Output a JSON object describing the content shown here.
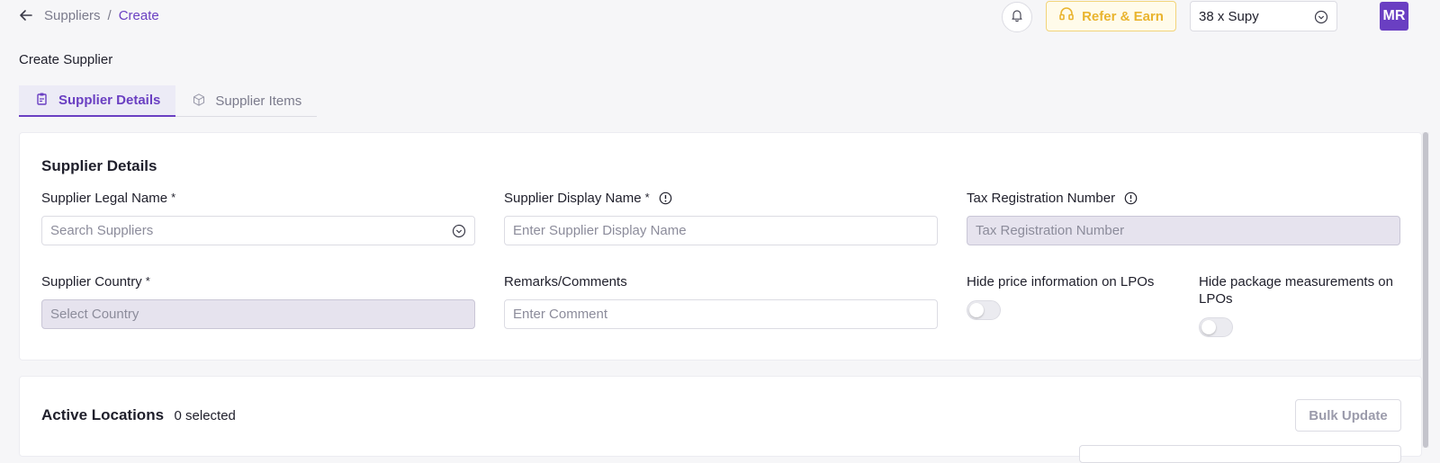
{
  "breadcrumb": {
    "parent": "Suppliers",
    "separator": "/",
    "current": "Create"
  },
  "header": {
    "refer_label": "Refer & Earn",
    "company_value": "38 x Supy",
    "avatar_initials": "MR"
  },
  "page": {
    "title": "Create Supplier"
  },
  "tabs": [
    {
      "label": "Supplier Details",
      "icon": "clipboard-icon",
      "active": true
    },
    {
      "label": "Supplier Items",
      "icon": "box-icon",
      "active": false
    }
  ],
  "details": {
    "heading": "Supplier Details",
    "legal_name": {
      "label": "Supplier Legal Name",
      "required": "*",
      "placeholder": "Search Suppliers"
    },
    "display_name": {
      "label": "Supplier Display Name",
      "required": "*",
      "placeholder": "Enter Supplier Display Name"
    },
    "tax": {
      "label": "Tax Registration Number",
      "placeholder": "Tax Registration Number"
    },
    "country": {
      "label": "Supplier Country",
      "required": "*",
      "placeholder": "Select Country"
    },
    "remarks": {
      "label": "Remarks/Comments",
      "placeholder": "Enter Comment"
    },
    "hide_price": {
      "label": "Hide price information on LPOs",
      "on": false
    },
    "hide_package": {
      "label_line1": "Hide package measurements on",
      "label_line2": "LPOs",
      "on": false
    }
  },
  "locations": {
    "heading": "Active Locations",
    "separator": "-",
    "selected_text": "0 selected",
    "bulk_label": "Bulk Update"
  },
  "colors": {
    "accent": "#6a3fc2",
    "refer": "#e9b42e",
    "disabled_field": "#e6e3ee"
  }
}
